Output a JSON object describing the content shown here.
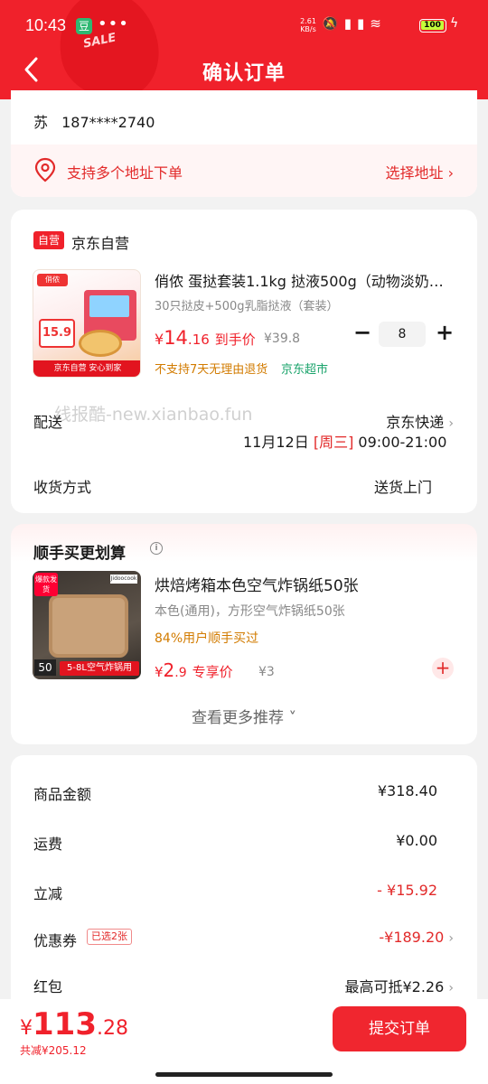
{
  "status_bar": {
    "time": "10:43",
    "app_badge": "豆",
    "dots": "•••",
    "net_speed": "2.61",
    "net_unit": "KB/s",
    "icons": [
      "mute-icon",
      "signal-icon",
      "signal-icon",
      "wifi-icon"
    ],
    "battery": "100",
    "battery_color": "#c4ff3a"
  },
  "header": {
    "title": "确认订单",
    "sale_text": "SALE",
    "bg_color": "#f0212b"
  },
  "address": {
    "name": "苏",
    "phone": "187****2740",
    "multi_text": "支持多个地址下单",
    "choose_text": "选择地址",
    "choose_chevron": "›"
  },
  "shop": {
    "badge": "自营",
    "name": "京东自营"
  },
  "product": {
    "name": "俏侬 蛋挞套装1.1kg 挞液500g（动物淡奶…",
    "spec": "30只挞皮+500g乳脂挞液（套装）",
    "price_yen": "¥",
    "price_int": "14",
    "price_dec": ".16",
    "price_tag": "到手价",
    "orig_price": "¥39.8",
    "quantity": "8",
    "minus": "−",
    "plus": "+",
    "no_return": "不支持7天无理由退货",
    "supermarket": "京东超市",
    "img_brand": "俏侬",
    "img_price": "15.9",
    "img_footer": "京东自营 安心到家"
  },
  "watermark": "线报酷-new.xianbao.fun",
  "delivery": {
    "label": "配送",
    "courier": "京东快递",
    "chevron": "›",
    "date": "11月12日",
    "weekday": "[周三]",
    "time": "09:00-21:00"
  },
  "receive": {
    "label": "收货方式",
    "value": "送货上门"
  },
  "recommend": {
    "title": "顺手买更划算",
    "info": "i",
    "name": "烘焙烤箱本色空气炸锅纸50张",
    "spec": "本色(通用)，方形空气炸锅纸50张",
    "bought": "84%用户顺手买过",
    "price_yen": "¥",
    "price_int": "2",
    "price_dec": ".9",
    "price_tag": "专享价",
    "orig_price": "¥3",
    "add": "+",
    "more": "查看更多推荐 ˅",
    "img_hot": "爆款发货",
    "img_brand": "Jidoocook",
    "img_num": "50",
    "img_size": "5-8L空气炸锅用"
  },
  "summary": {
    "goods_label": "商品金额",
    "goods_value": "¥318.40",
    "shipping_label": "运费",
    "shipping_value": "¥0.00",
    "discount_label": "立减",
    "discount_value": "- ¥15.92",
    "coupon_label": "优惠券",
    "coupon_tag": "已选2张",
    "coupon_value": "-¥189.20",
    "coupon_chevron": "›",
    "redpacket_label": "红包",
    "redpacket_value": "最高可抵¥2.26",
    "redpacket_chevron": "›"
  },
  "bottom": {
    "total_yen": "¥",
    "total_int": "113",
    "total_dec": ".28",
    "saved": "共减¥205.12",
    "submit": "提交订单"
  }
}
